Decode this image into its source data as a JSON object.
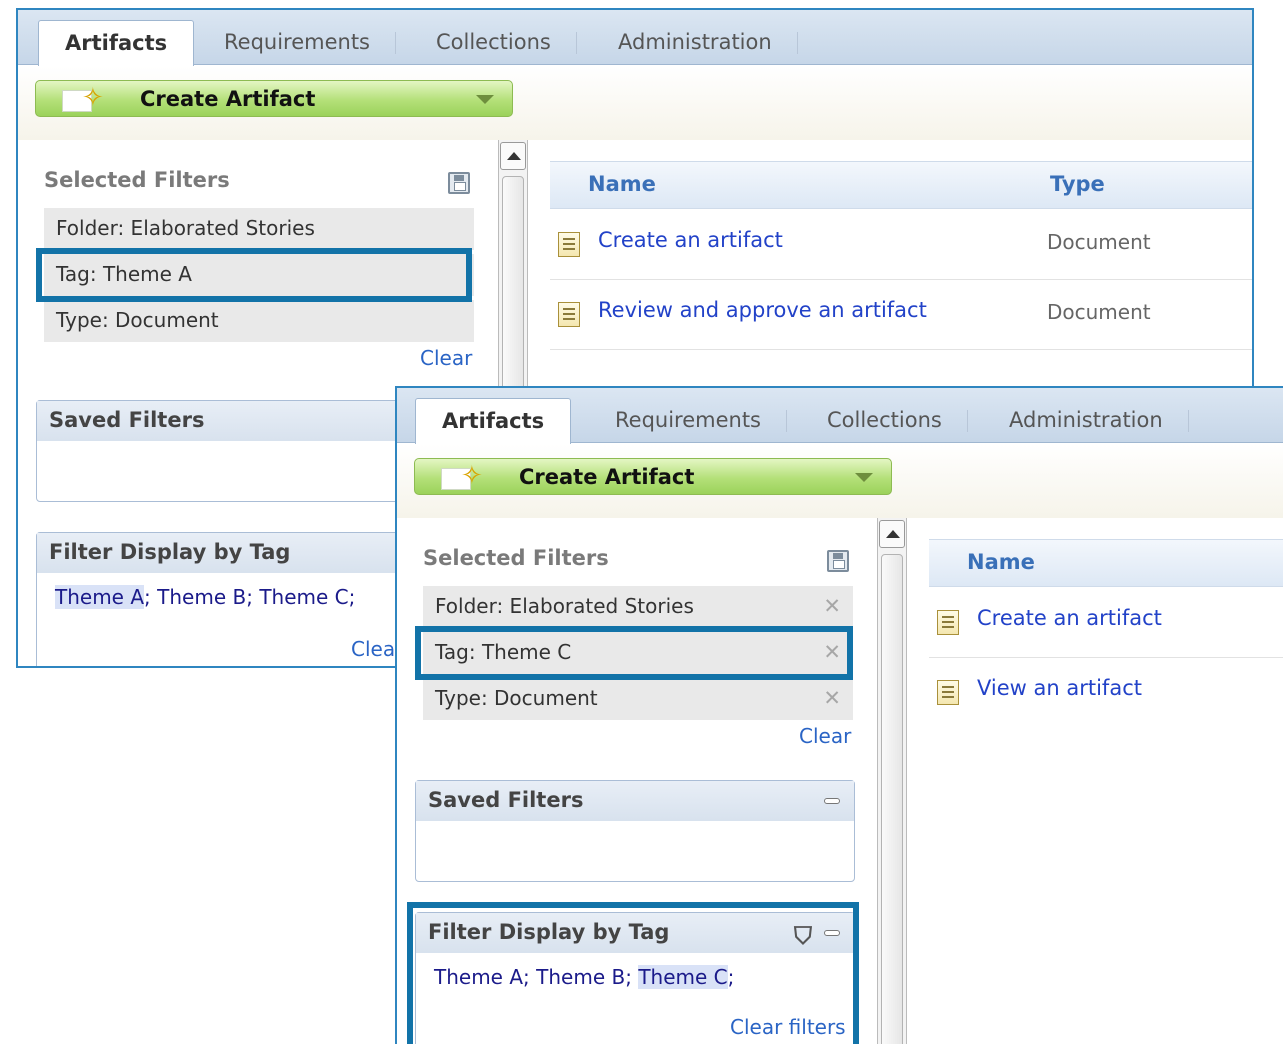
{
  "top_window": {
    "tabs": [
      {
        "label": "Artifacts",
        "active": true
      },
      {
        "label": "Requirements",
        "active": false
      },
      {
        "label": "Collections",
        "active": false
      },
      {
        "label": "Administration",
        "active": false
      }
    ],
    "create_button": "Create Artifact",
    "selected_filters": {
      "title": "Selected Filters",
      "items": [
        "Folder: Elaborated Stories",
        "Tag: Theme A",
        "Type: Document"
      ],
      "clear_label": "Clear"
    },
    "saved_filters": {
      "title": "Saved Filters"
    },
    "filter_by_tag": {
      "title": "Filter Display by Tag",
      "tags": [
        "Theme A",
        "Theme B",
        "Theme C"
      ],
      "selected_tag": "Theme A",
      "clear_label": "Clear filters"
    },
    "grid": {
      "columns": [
        "Name",
        "Type"
      ],
      "rows": [
        {
          "name": "Create an artifact",
          "type": "Document"
        },
        {
          "name": "Review and approve an artifact",
          "type": "Document"
        }
      ]
    }
  },
  "bottom_window": {
    "tabs": [
      {
        "label": "Artifacts",
        "active": true
      },
      {
        "label": "Requirements",
        "active": false
      },
      {
        "label": "Collections",
        "active": false
      },
      {
        "label": "Administration",
        "active": false
      }
    ],
    "create_button": "Create Artifact",
    "selected_filters": {
      "title": "Selected Filters",
      "items": [
        "Folder: Elaborated Stories",
        "Tag: Theme C",
        "Type: Document"
      ],
      "clear_label": "Clear"
    },
    "saved_filters": {
      "title": "Saved Filters"
    },
    "filter_by_tag": {
      "title": "Filter Display by Tag",
      "tags": [
        "Theme A",
        "Theme B",
        "Theme C"
      ],
      "selected_tag": "Theme C",
      "clear_label": "Clear filters"
    },
    "grid": {
      "columns": [
        "Name"
      ],
      "rows": [
        {
          "name": "Create an artifact"
        },
        {
          "name": "View an artifact"
        }
      ]
    }
  },
  "colors": {
    "frame_border": "#2f86c0",
    "highlight_box": "#1273a8",
    "link": "#2242c8",
    "create_button_green": "#b4e079"
  },
  "icons": [
    "favorite-star-icon",
    "dropdown-caret-icon",
    "save-icon",
    "remove-filter-icon",
    "minimize-icon",
    "tag-add-icon",
    "document-icon",
    "scroll-up-icon"
  ]
}
